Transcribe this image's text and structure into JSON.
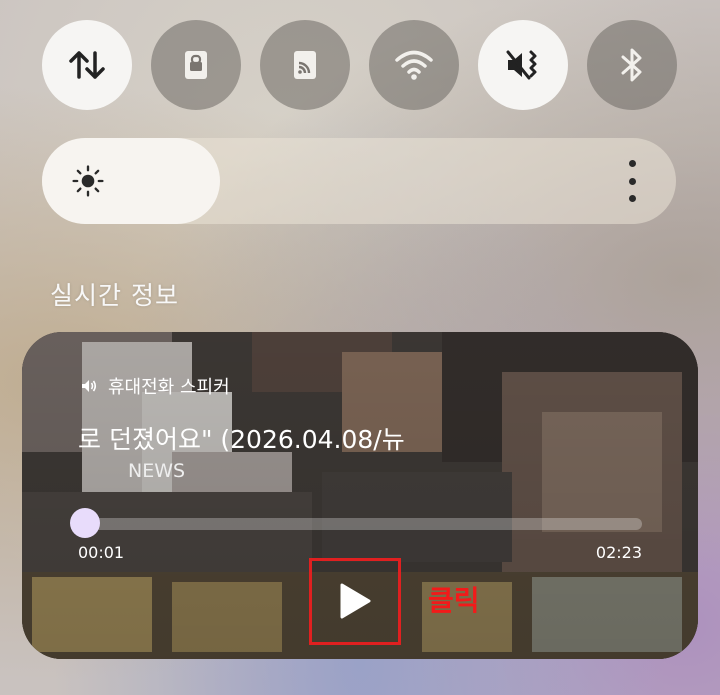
{
  "quick_settings": [
    {
      "name": "mobile-data",
      "icon": "data-arrows-icon",
      "on": true
    },
    {
      "name": "screen-lock",
      "icon": "lock-icon",
      "on": false
    },
    {
      "name": "cast",
      "icon": "cast-icon",
      "on": false
    },
    {
      "name": "wifi",
      "icon": "wifi-icon",
      "on": false
    },
    {
      "name": "sound",
      "icon": "vibrate-mute-icon",
      "on": true
    },
    {
      "name": "bluetooth",
      "icon": "bluetooth-icon",
      "on": false
    }
  ],
  "brightness": {
    "level": 0.28,
    "icon": "sun-icon",
    "more_icon": "more-vertical-icon"
  },
  "section_title": "실시간 정보",
  "media": {
    "output_device": "휴대전화 스피커",
    "title": "로 던졌어요\" (2026.04.08/뉴",
    "artist": "NEWS",
    "current_time": "00:01",
    "total_time": "02:23",
    "progress": 0.007,
    "play_icon": "play-icon"
  },
  "annotation": {
    "label": "클릭",
    "color": "#e02020"
  }
}
